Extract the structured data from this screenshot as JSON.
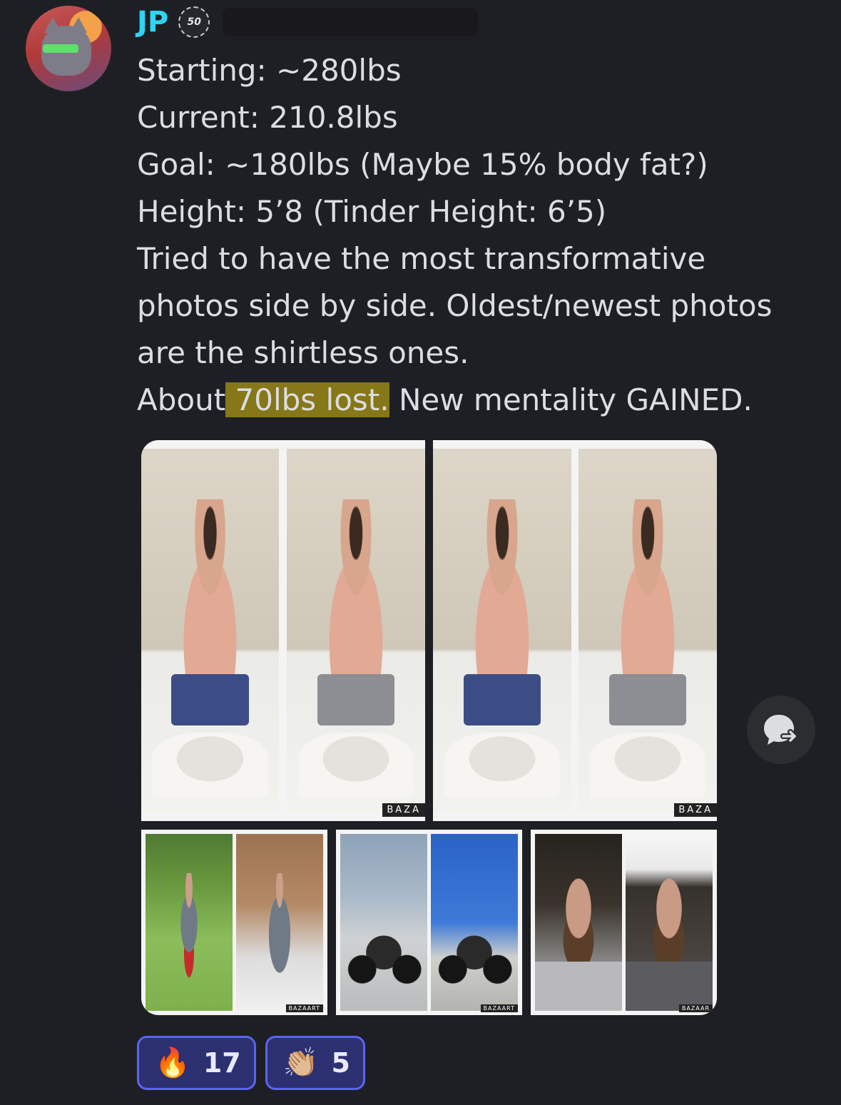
{
  "author": {
    "username": "JP",
    "badge_label": "50"
  },
  "message": {
    "lines": [
      "Starting: ~280lbs",
      "Current: 210.8lbs",
      "Goal: ~180lbs (Maybe 15% body fat?)",
      "Height: 5’8 (Tinder Height: 6’5)",
      "Tried to have the most transformative",
      "photos side by side. Oldest/newest photos",
      "are the shirtless ones."
    ],
    "last_line_before": "About",
    "last_line_highlight": " 70lbs lost.",
    "last_line_after": " New mentality GAINED."
  },
  "attachments": {
    "watermark_large": "BAZA",
    "watermark_small": "BAZAART",
    "watermark_small_cut": "BAZAAR"
  },
  "reactions": [
    {
      "emoji": "🔥",
      "count": "17"
    },
    {
      "emoji": "👏🏼",
      "count": "5"
    }
  ],
  "colors": {
    "background": "#1e1f24",
    "username": "#2fd4f2",
    "reaction_border": "#5865f2",
    "reaction_bg": "#2c3070",
    "highlight": "#aa9614"
  }
}
